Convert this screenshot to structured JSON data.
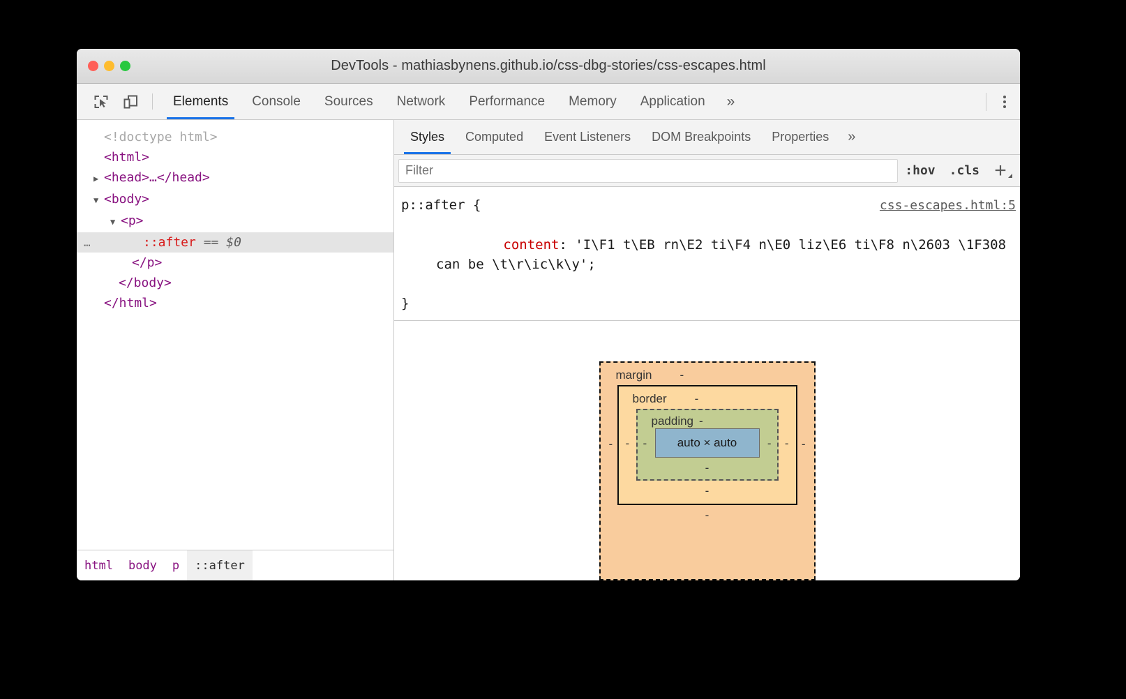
{
  "window": {
    "title": "DevTools - mathiasbynens.github.io/css-dbg-stories/css-escapes.html",
    "traffic_lights": [
      "close",
      "minimize",
      "maximize"
    ]
  },
  "toolbar": {
    "icons": [
      {
        "name": "inspect-element-icon",
        "label": "Inspect element"
      },
      {
        "name": "device-toolbar-icon",
        "label": "Toggle device toolbar"
      }
    ],
    "tabs": [
      {
        "label": "Elements",
        "active": true
      },
      {
        "label": "Console",
        "active": false
      },
      {
        "label": "Sources",
        "active": false
      },
      {
        "label": "Network",
        "active": false
      },
      {
        "label": "Performance",
        "active": false
      },
      {
        "label": "Memory",
        "active": false
      },
      {
        "label": "Application",
        "active": false
      }
    ],
    "more_label": "»",
    "kebab_label": "Customize and control DevTools"
  },
  "dom_tree": {
    "rows": [
      {
        "twisty": "",
        "text": "<!doctype html>",
        "kind": "doctype",
        "indent": 0,
        "selected": false
      },
      {
        "twisty": "",
        "text": "<html>",
        "kind": "tag",
        "indent": 0,
        "selected": false
      },
      {
        "twisty": "▶",
        "text": "<head>…</head>",
        "kind": "tag",
        "indent": 1,
        "selected": false
      },
      {
        "twisty": "▼",
        "text": "<body>",
        "kind": "tag",
        "indent": 1,
        "selected": false
      },
      {
        "twisty": "▼",
        "text": "<p>",
        "kind": "tag",
        "indent": 2,
        "selected": false
      },
      {
        "twisty": "",
        "text": "::after",
        "suffix_eq": "==",
        "suffix_var": "$0",
        "kind": "pseudo",
        "indent": 4,
        "selected": true,
        "gutter": "…"
      },
      {
        "twisty": "",
        "text": "</p>",
        "kind": "tag",
        "indent": 3,
        "selected": false
      },
      {
        "twisty": "",
        "text": "</body>",
        "kind": "tag",
        "indent": 2,
        "selected": false
      },
      {
        "twisty": "",
        "text": "</html>",
        "kind": "tag",
        "indent": 1,
        "selected": false
      }
    ]
  },
  "breadcrumb": {
    "items": [
      {
        "label": "html",
        "active": false
      },
      {
        "label": "body",
        "active": false
      },
      {
        "label": "p",
        "active": false
      },
      {
        "label": "::after",
        "active": true
      }
    ]
  },
  "styles_panel": {
    "tabs": [
      {
        "label": "Styles",
        "active": true
      },
      {
        "label": "Computed",
        "active": false
      },
      {
        "label": "Event Listeners",
        "active": false
      },
      {
        "label": "DOM Breakpoints",
        "active": false
      },
      {
        "label": "Properties",
        "active": false
      }
    ],
    "more_label": "»",
    "filter_placeholder": "Filter",
    "filter_value": "",
    "hov_label": ":hov",
    "cls_label": ".cls",
    "new_rule_label": "+"
  },
  "css_rule": {
    "selector": "p::after {",
    "source_link": "css-escapes.html:5",
    "property": "content",
    "colon": ": ",
    "value_line_1": "'I\\F1 t\\EB rn\\E2 ti\\F4 n\\E0 liz\\E6 ti\\F8 n\\2603 \\1F308",
    "value_line_2": "can be \\t\\r\\ic\\k\\y';",
    "closing_brace": "}"
  },
  "box_model": {
    "margin_label": "margin",
    "border_label": "border",
    "padding_label": "padding",
    "content_label": "auto × auto",
    "dash": "-",
    "colors": {
      "margin": "#f9cc9d",
      "border": "#fdd9a0",
      "padding": "#c2cd92",
      "content": "#8fb5cd"
    },
    "margin_values": {
      "top": "-",
      "right": "-",
      "bottom": "-",
      "left": "-"
    },
    "border_values": {
      "top": "-",
      "right": "-",
      "bottom": "-",
      "left": "-"
    },
    "padding_values": {
      "top": "-",
      "right": "-",
      "bottom": "-",
      "left": "-"
    }
  },
  "theme": {
    "accent": "#1a73e8",
    "tag_color": "#881280",
    "pseudo_color": "#d81b1b",
    "property_color": "#c80000"
  }
}
